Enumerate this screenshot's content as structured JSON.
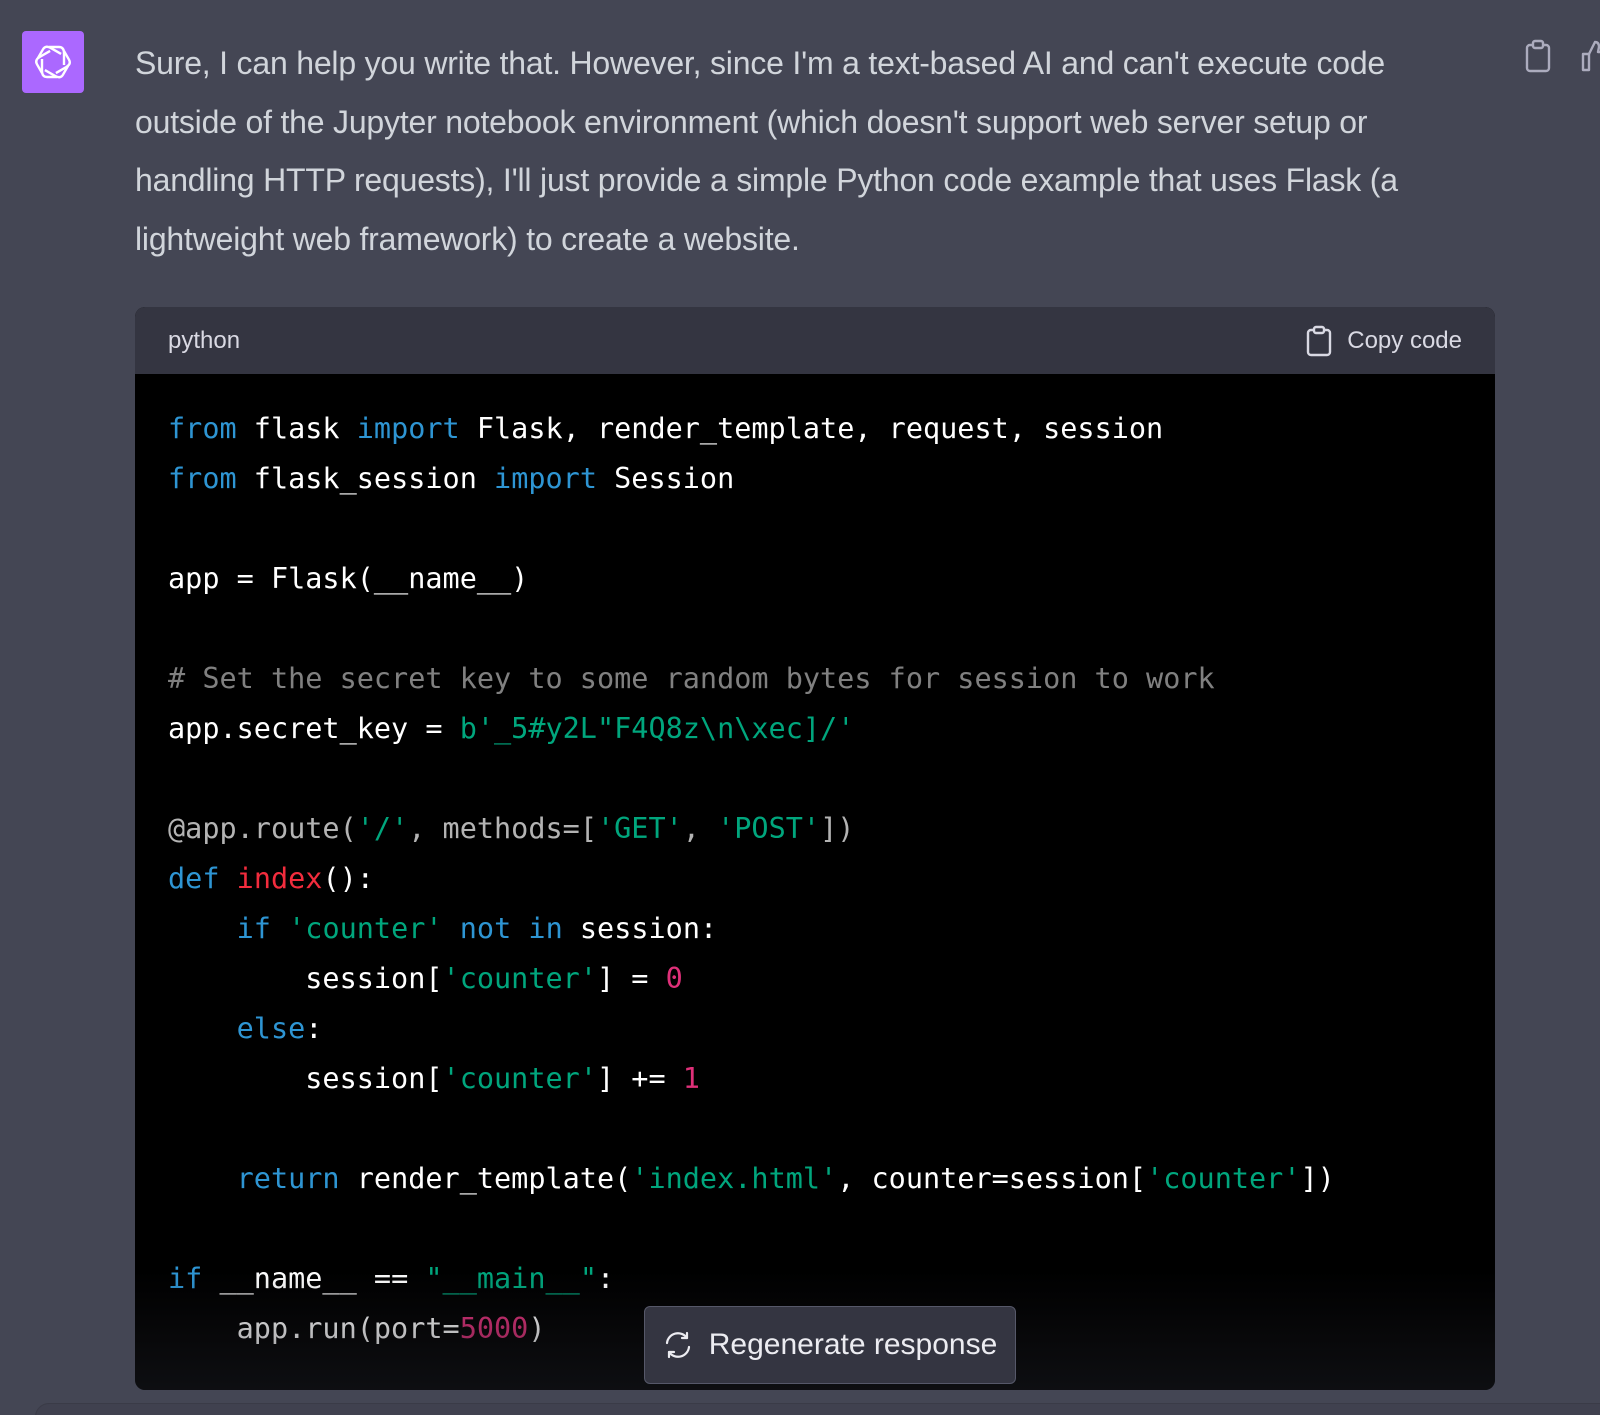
{
  "assistant": {
    "avatar_icon": "openai-logo-icon",
    "accent": "#ab68ff"
  },
  "message": {
    "text": "Sure, I can help you write that. However, since I'm a text-based AI and can't execute code outside of the Jupyter notebook environment (which doesn't support web server setup or handling HTTP requests), I'll just provide a simple Python code example that uses Flask (a lightweight web framework) to create a website."
  },
  "code_block": {
    "language": "python",
    "copy_label": "Copy code",
    "lines": [
      [
        {
          "t": "from",
          "c": "kw"
        },
        {
          "t": " flask "
        },
        {
          "t": "import",
          "c": "kw"
        },
        {
          "t": " Flask, render_template, request, session"
        }
      ],
      [
        {
          "t": "from",
          "c": "kw"
        },
        {
          "t": " flask_session "
        },
        {
          "t": "import",
          "c": "kw"
        },
        {
          "t": " Session"
        }
      ],
      [],
      [
        {
          "t": "app = Flask(__name__)"
        }
      ],
      [],
      [
        {
          "t": "# Set the secret key to some random bytes for session to work",
          "c": "cm"
        }
      ],
      [
        {
          "t": "app.secret_key = "
        },
        {
          "t": "b'_5#y2L\"F4Q8z\\n\\xec]/'",
          "c": "st"
        }
      ],
      [],
      [
        {
          "t": "@app.route(",
          "c": "dc"
        },
        {
          "t": "'/'",
          "c": "st"
        },
        {
          "t": ", methods=[",
          "c": "dc"
        },
        {
          "t": "'GET'",
          "c": "st"
        },
        {
          "t": ", ",
          "c": "dc"
        },
        {
          "t": "'POST'",
          "c": "st"
        },
        {
          "t": "])",
          "c": "dc"
        }
      ],
      [
        {
          "t": "def",
          "c": "kw"
        },
        {
          "t": " "
        },
        {
          "t": "index",
          "c": "fn"
        },
        {
          "t": "():"
        }
      ],
      [
        {
          "t": "    "
        },
        {
          "t": "if",
          "c": "kw"
        },
        {
          "t": " "
        },
        {
          "t": "'counter'",
          "c": "st"
        },
        {
          "t": " "
        },
        {
          "t": "not",
          "c": "kw"
        },
        {
          "t": " "
        },
        {
          "t": "in",
          "c": "kw"
        },
        {
          "t": " session:"
        }
      ],
      [
        {
          "t": "        session["
        },
        {
          "t": "'counter'",
          "c": "st"
        },
        {
          "t": "] = "
        },
        {
          "t": "0",
          "c": "nm"
        }
      ],
      [
        {
          "t": "    "
        },
        {
          "t": "else",
          "c": "kw"
        },
        {
          "t": ":"
        }
      ],
      [
        {
          "t": "        session["
        },
        {
          "t": "'counter'",
          "c": "st"
        },
        {
          "t": "] += "
        },
        {
          "t": "1",
          "c": "nm"
        }
      ],
      [],
      [
        {
          "t": "    "
        },
        {
          "t": "return",
          "c": "kw"
        },
        {
          "t": " render_template("
        },
        {
          "t": "'index.html'",
          "c": "st"
        },
        {
          "t": ", counter=session["
        },
        {
          "t": "'counter'",
          "c": "st"
        },
        {
          "t": "])"
        }
      ],
      [],
      [
        {
          "t": "if",
          "c": "kw"
        },
        {
          "t": " __name__ == "
        },
        {
          "t": "\"__main__\"",
          "c": "st"
        },
        {
          "t": ":"
        }
      ],
      [
        {
          "t": "    app.run(port="
        },
        {
          "t": "5000",
          "c": "nm"
        },
        {
          "t": ")"
        }
      ]
    ]
  },
  "regenerate": {
    "label": "Regenerate response"
  },
  "colors": {
    "page_bg": "#444654",
    "code_header_bg": "#343541",
    "code_bg": "#000000",
    "keyword": "#2e95d3",
    "string": "#00a67d",
    "function": "#f22c3d",
    "number": "#df3079"
  }
}
